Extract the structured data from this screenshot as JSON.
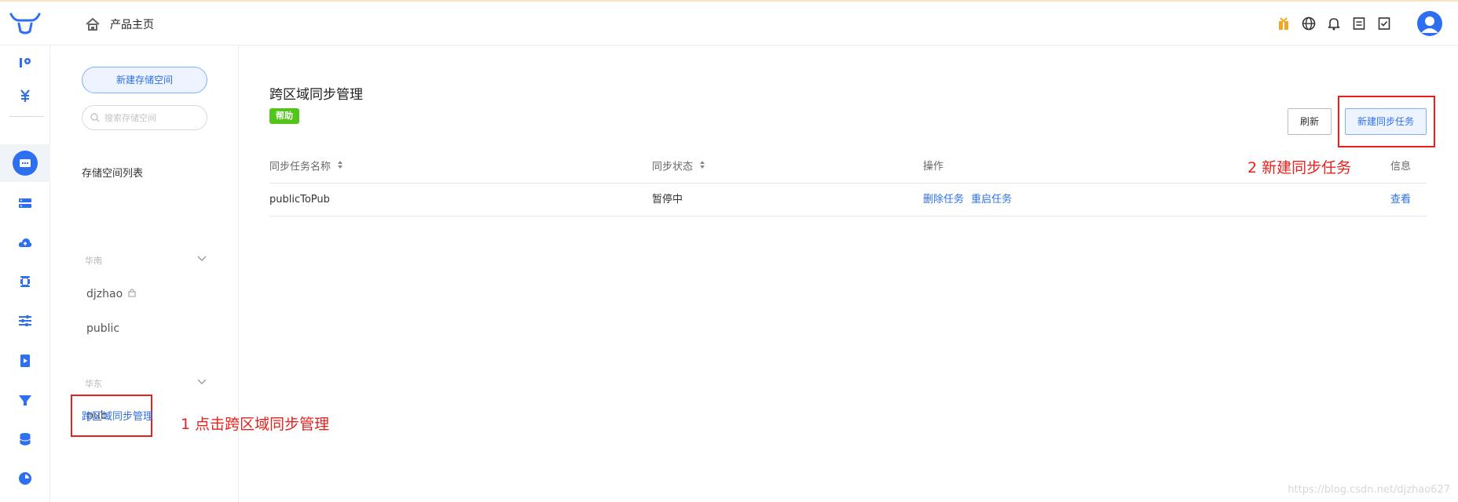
{
  "header": {
    "home_label": "产品主页"
  },
  "sidebar": {
    "new_space_button": "新建存储空间",
    "search_placeholder": "搜索存储空间",
    "list_title": "存储空间列表",
    "regions": [
      {
        "name": "华南",
        "buckets": [
          {
            "name": "djzhao",
            "locked": true
          },
          {
            "name": "public",
            "locked": false
          }
        ]
      },
      {
        "name": "华东",
        "buckets": [
          {
            "name": "pub",
            "locked": false
          }
        ]
      }
    ],
    "crr_link": "跨区域同步管理"
  },
  "main": {
    "title": "跨区域同步管理",
    "help_badge": "帮助",
    "refresh_button": "刷新",
    "new_task_button": "新建同步任务",
    "table": {
      "headers": {
        "name": "同步任务名称",
        "status": "同步状态",
        "actions": "操作",
        "info": "信息"
      },
      "rows": [
        {
          "name": "publicToPub",
          "status": "暂停中",
          "action_delete": "删除任务",
          "action_restart": "重启任务",
          "info": "查看"
        }
      ]
    }
  },
  "annotations": {
    "step1": "1 点击跨区域同步管理",
    "step2": "2 新建同步任务"
  },
  "watermark": "https://blog.csdn.net/djzhao627",
  "colors": {
    "primary": "#2d6ff0",
    "help_green": "#52c41a",
    "annotation_red": "#e8211c"
  }
}
